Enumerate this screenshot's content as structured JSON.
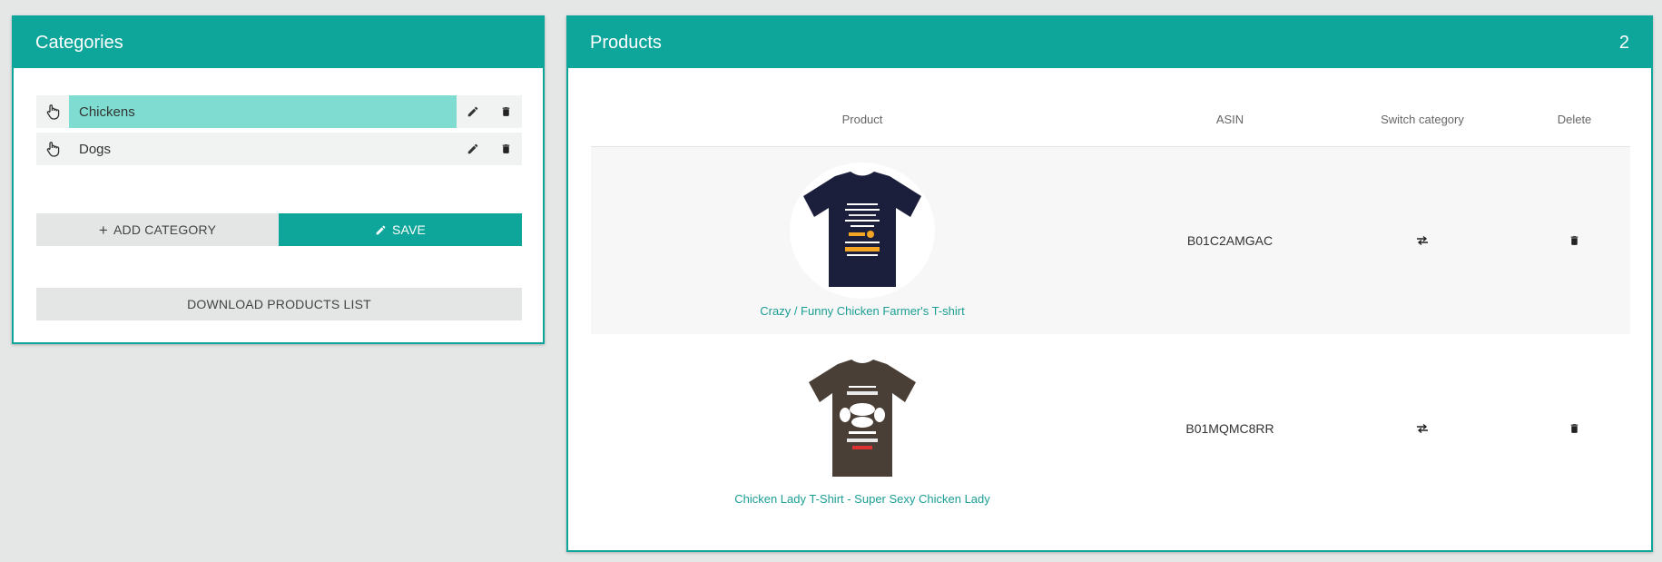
{
  "categories": {
    "title": "Categories",
    "items": [
      {
        "label": "Chickens",
        "selected": true
      },
      {
        "label": "Dogs",
        "selected": false
      }
    ],
    "add_label": "ADD CATEGORY",
    "save_label": "SAVE",
    "download_label": "DOWNLOAD PRODUCTS LIST"
  },
  "products": {
    "title": "Products",
    "count": "2",
    "columns": [
      "Product",
      "ASIN",
      "Switch category",
      "Delete"
    ],
    "rows": [
      {
        "name": "Crazy / Funny Chicken Farmer's T-shirt",
        "asin": "B01C2AMGAC",
        "shirt_color": "#1c1f3b"
      },
      {
        "name": "Chicken Lady T-Shirt - Super Sexy Chicken Lady",
        "asin": "B01MQMC8RR",
        "shirt_color": "#4a3f37"
      }
    ]
  },
  "colors": {
    "accent": "#0ea59b",
    "selected": "#7fdcd1"
  }
}
